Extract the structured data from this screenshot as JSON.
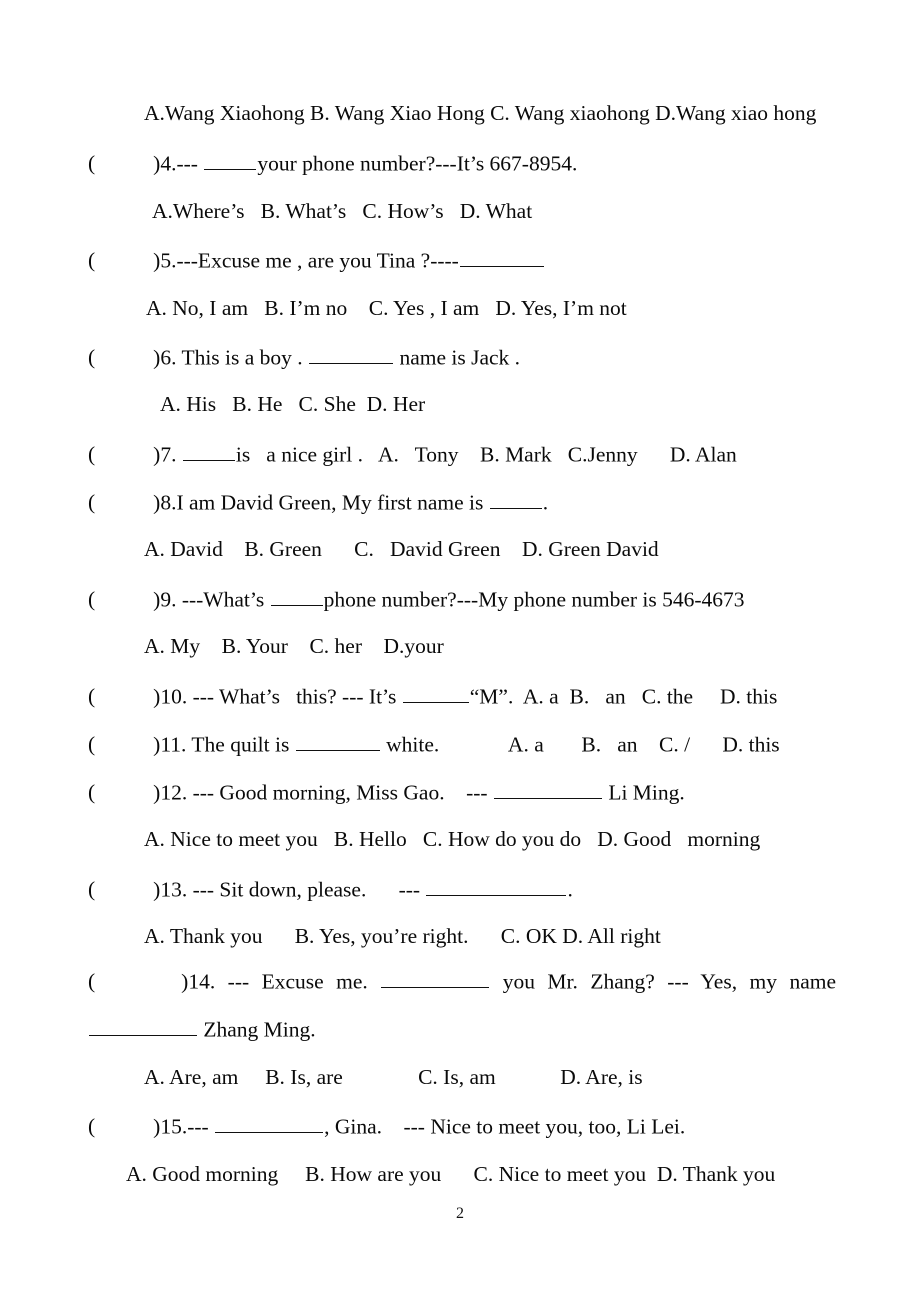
{
  "document": {
    "type": "english-exam-worksheet",
    "page_number": "2",
    "background_color": "#ffffff",
    "text_color": "#0a0a0a"
  },
  "lines": {
    "q3_options": "A.Wang Xiaohong B. Wang Xiao Hong C. Wang xiaohong D.Wang xiao hong",
    "q4_stem_a": "(",
    "q4_stem_b": ")4.--- ",
    "q4_stem_c": "your phone number?---It’s 667-8954.",
    "q4_options": "A.Where’s   B. What’s   C. How’s   D. What",
    "q5_stem_a": "(",
    "q5_stem_b": ")5.---Excuse me , are you Tina ?----",
    "q5_options": "A. No, I am   B. I’m no    C. Yes , I am   D. Yes, I’m not",
    "q6_stem_a": "(",
    "q6_stem_b": ")6. This is a boy . ",
    "q6_stem_c": " name is Jack .",
    "q6_options": "A. His   B. He   C. She  D. Her",
    "q7_stem_a": "(",
    "q7_stem_b": ")7. ",
    "q7_stem_c": "is   a nice girl .   A.   Tony    B. Mark   C.Jenny      D. Alan",
    "q8_stem_a": "(",
    "q8_stem_b": ")8.I am David Green, My first name is ",
    "q8_stem_c": ".",
    "q8_options": "A. David    B. Green      C.   David Green    D. Green David",
    "q9_stem_a": "(",
    "q9_stem_b": ")9. ---What’s ",
    "q9_stem_c": "phone number?---My phone number is 546-4673",
    "q9_options": "A. My    B. Your    C. her    D.your",
    "q10_stem_a": "(",
    "q10_stem_b": ")10. --- What’s   this? --- It’s ",
    "q10_stem_c": "“M”.  A. a  B.   an   C. the     D. this",
    "q11_stem_a": "(",
    "q11_stem_b": ")11. The quilt is ",
    "q11_stem_c": " white.             A. a       B.   an    C. /      D. this",
    "q12_stem_a": "(",
    "q12_stem_b": ")12. --- Good morning, Miss Gao.    --- ",
    "q12_stem_c": " Li Ming.",
    "q12_options": "A. Nice to meet you   B. Hello   C. How do you do   D. Good   morning",
    "q13_stem_a": "(",
    "q13_stem_b": ")13. --- Sit down, please.      --- ",
    "q13_stem_c": ".",
    "q13_options": "A. Thank you      B. Yes, you’re right.      C. OK D. All right",
    "q14_stem_a": "(",
    "q14_stem_b": ")14.",
    "q14_w1": "---",
    "q14_w2": "Excuse",
    "q14_w3": "me.",
    "q14_w4": "you",
    "q14_w5": "Mr.",
    "q14_w6": "Zhang?",
    "q14_w7": "---",
    "q14_w8": "Yes,",
    "q14_w9": "my",
    "q14_w10": "name",
    "q14_cont": " Zhang Ming.",
    "q14_options": "A. Are, am     B. Is, are              C. Is, am            D. Are, is",
    "q15_stem_a": "(",
    "q15_stem_b": ")15.--- ",
    "q15_stem_c": ", Gina.    --- Nice to meet you, too, Li Lei.",
    "q15_options": "A. Good morning     B. How are you      C. Nice to meet you  D. Thank you"
  },
  "footer": {
    "page_number": "2"
  }
}
